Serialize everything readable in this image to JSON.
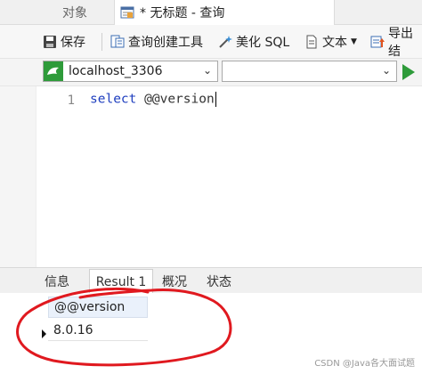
{
  "tabs": {
    "objects": "对象",
    "query": "* 无标题 - 查询"
  },
  "toolbar": {
    "save": "保存",
    "query_builder": "查询创建工具",
    "beautify_sql": "美化 SQL",
    "text": "文本",
    "export": "导出结"
  },
  "connection": {
    "selected": "localhost_3306",
    "database": ""
  },
  "editor": {
    "line_number": "1",
    "keyword": "select",
    "expression": "@@version"
  },
  "result_tabs": {
    "info": "信息",
    "result1": "Result 1",
    "profile": "概况",
    "status": "状态"
  },
  "results": {
    "column": "@@version",
    "value": "8.0.16"
  },
  "watermark": "CSDN @Java各大面试题",
  "colors": {
    "annotation_circle": "#e0191f",
    "keyword": "#1f3fbf",
    "connection_icon": "#2e9b3a"
  }
}
